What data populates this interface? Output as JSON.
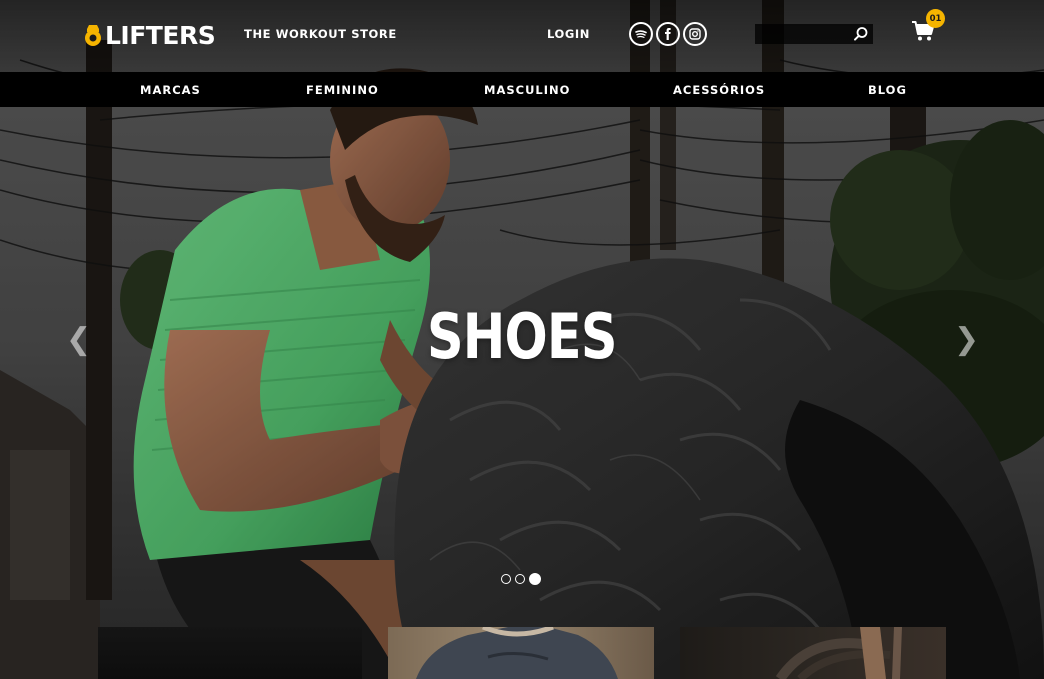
{
  "header": {
    "logo_text": "LIFTERS",
    "tagline": "THE WORKOUT STORE",
    "login_label": "LOGIN",
    "social": [
      "spotify-icon",
      "facebook-icon",
      "instagram-icon"
    ],
    "search": {
      "placeholder": "",
      "value": ""
    },
    "cart_count": "01"
  },
  "nav": {
    "items": [
      {
        "label": "MARCAS"
      },
      {
        "label": "FEMININO"
      },
      {
        "label": "MASCULINO"
      },
      {
        "label": "ACESSÓRIOS"
      },
      {
        "label": "BLOG"
      }
    ]
  },
  "slider": {
    "title": "SHOES",
    "prev_label": "❮",
    "next_label": "❯",
    "slide_count": 3,
    "active_slide": 3
  },
  "colors": {
    "accent": "#f5b400",
    "nav_bg": "#000000",
    "shirt": "#4fb66a"
  }
}
